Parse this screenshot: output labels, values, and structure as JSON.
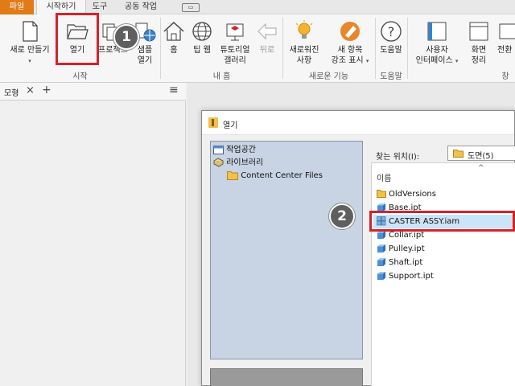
{
  "tabs": {
    "file": "파일",
    "start": "시작하기",
    "tools": "도구",
    "collab": "공동 작업"
  },
  "ribbon": {
    "new_label": "새로 만들기",
    "open_label": "열기",
    "projects_label": "프로젝트",
    "samples_line1": "샘플",
    "samples_line2": "열기",
    "home_label": "홈",
    "tips_label": "팁 웹",
    "tutorial_line1": "튜토리얼",
    "tutorial_line2": "갤러리",
    "back_label": "뒤로",
    "whatsnew_line1": "새로워진",
    "whatsnew_line2": "사항",
    "highlight_line1": "새 항목",
    "highlight_line2": "강조 표시",
    "help_label": "도움말",
    "ui_line1": "사용자",
    "ui_line2": "인터페이스",
    "arrange_line1": "화면",
    "arrange_line2": "정리",
    "switch_label": "전환",
    "group_start": "시작",
    "group_myhome": "내 홈",
    "group_new_features": "새로운 기능",
    "group_help": "도움말",
    "group_window": "창"
  },
  "badges": {
    "step1": "1",
    "step2": "2"
  },
  "panel": {
    "title": "모형",
    "close": "×",
    "add": "+",
    "menu": "≡"
  },
  "dialog": {
    "title": "열기",
    "locations": [
      {
        "label": "작업공간",
        "icon": "workspace-icon"
      },
      {
        "label": "라이브러리",
        "icon": "library-icon"
      },
      {
        "label": "Content Center Files",
        "icon": "folder-icon"
      }
    ],
    "lookin_label": "찾는 위치(I):",
    "lookin_value": "도면(5)",
    "column_name": "이름",
    "files": [
      {
        "name": "OldVersions",
        "type": "folder"
      },
      {
        "name": "Base.ipt",
        "type": "part"
      },
      {
        "name": "CASTER ASSY.iam",
        "type": "assembly"
      },
      {
        "name": "Collar.ipt",
        "type": "part"
      },
      {
        "name": "Pulley.ipt",
        "type": "part"
      },
      {
        "name": "Shaft.ipt",
        "type": "part"
      },
      {
        "name": "Support.ipt",
        "type": "part"
      }
    ]
  },
  "colors": {
    "file_tab": "#e07b17",
    "highlight": "#d2232a",
    "badge": "#5f5f5f",
    "location_pane": "#c8d4e3",
    "folder": "#f2c04c",
    "part": "#4a90d9"
  }
}
